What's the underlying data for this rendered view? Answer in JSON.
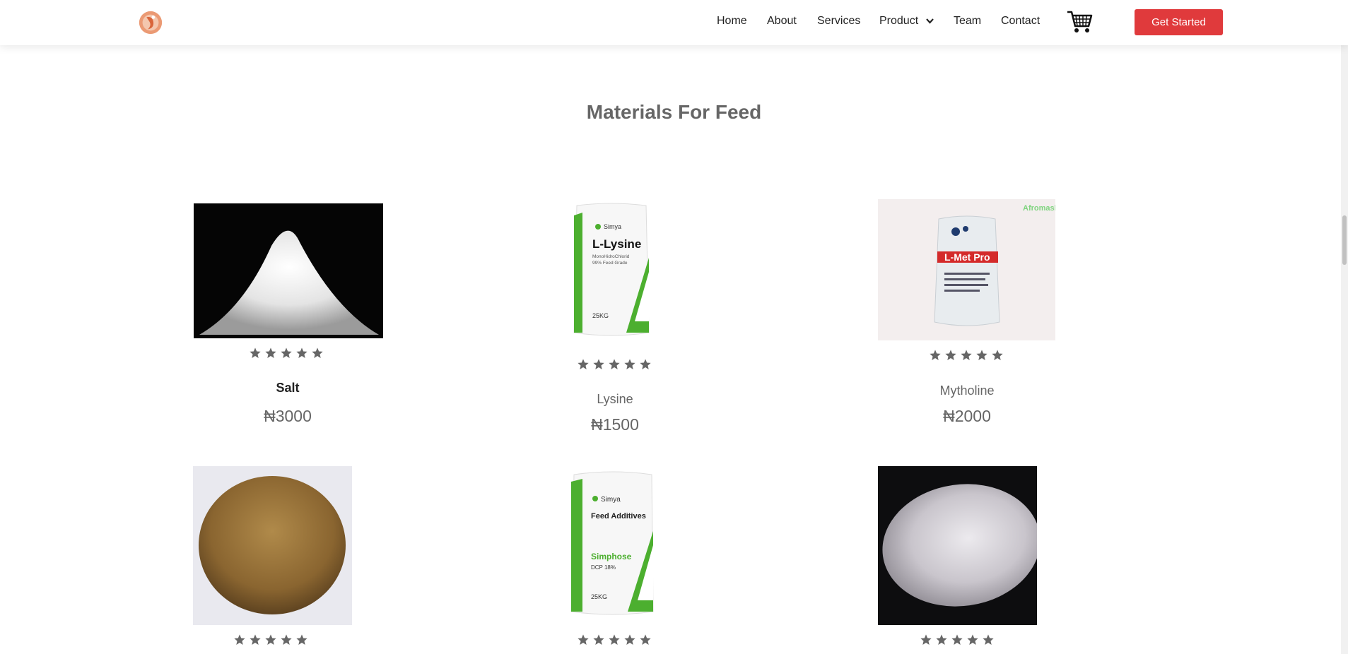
{
  "header": {
    "logo_icon": "brand-logo-icon",
    "nav": [
      {
        "label": "Home"
      },
      {
        "label": "About"
      },
      {
        "label": "Services"
      },
      {
        "label": "Product"
      },
      {
        "label": "Team"
      },
      {
        "label": "Contact"
      }
    ],
    "cart_icon": "shopping-cart-icon",
    "cta_label": "Get Started"
  },
  "colors": {
    "accent": "#e03a3c",
    "logo": "#e8875f",
    "star": "#666666",
    "lysine_green": "#4caf2f"
  },
  "section": {
    "title": "Materials For Feed"
  },
  "products": [
    {
      "name": "Salt",
      "price": "₦3000",
      "rating": 5,
      "image": "white-powder-pile"
    },
    {
      "name": "Lysine",
      "price": "₦1500",
      "rating": 5,
      "image": "l-lysine-bag"
    },
    {
      "name": "Mytholine",
      "price": "₦2000",
      "rating": 5,
      "image": "l-met-pro-bag"
    },
    {
      "name": "",
      "price": "",
      "rating": 5,
      "image": "brown-meal-pile"
    },
    {
      "name": "",
      "price": "",
      "rating": 5,
      "image": "feed-additives-bag"
    },
    {
      "name": "",
      "price": "",
      "rating": 5,
      "image": "white-granules-pile"
    }
  ],
  "image_text": {
    "lysine_brand": "Simya",
    "lysine_title": "L-Lysine",
    "lysine_sub1": "MonoHidroChlorid",
    "lysine_sub2": "99% Feed Grade",
    "lysine_weight": "25KG",
    "lmet_title": "L-Met Pro",
    "lmet_watermark": "Afromash",
    "fa_brand": "Simya",
    "fa_title": "Feed Additives",
    "fa_product": "Simphose",
    "fa_sub": "DCP 18%",
    "fa_weight": "25KG"
  }
}
